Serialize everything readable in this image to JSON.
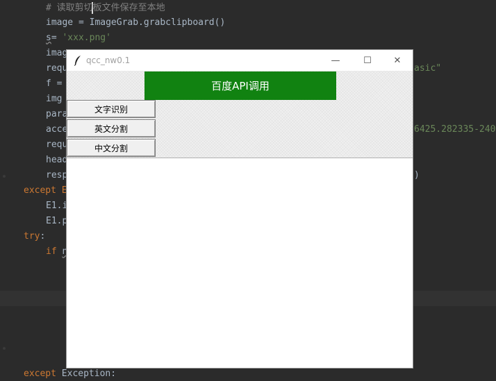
{
  "editor": {
    "lines": [
      {
        "id": "l1",
        "segments": [
          {
            "t": "# 读取剪切板文件保存至本地",
            "c": "c-comment"
          }
        ]
      },
      {
        "id": "l2",
        "segments": [
          {
            "t": "image = ImageGrab.grabclipboard()",
            "c": ""
          }
        ]
      },
      {
        "id": "l3",
        "segments": [
          {
            "t": "s",
            "c": "squiggle"
          },
          {
            "t": "= ",
            "c": ""
          },
          {
            "t": "'xxx.png'",
            "c": "c-str"
          }
        ]
      },
      {
        "id": "l4",
        "segments": [
          {
            "t": "imag",
            "c": ""
          }
        ]
      },
      {
        "id": "l5",
        "segments": [
          {
            "t": "requ",
            "c": ""
          }
        ]
      },
      {
        "id": "l6",
        "segments": [
          {
            "t": "f =",
            "c": ""
          }
        ]
      },
      {
        "id": "l7",
        "segments": [
          {
            "t": "img",
            "c": ""
          }
        ]
      },
      {
        "id": "l8",
        "segments": [
          {
            "t": "para",
            "c": ""
          }
        ]
      },
      {
        "id": "l9",
        "segments": [
          {
            "t": "acce",
            "c": ""
          }
        ]
      },
      {
        "id": "l10",
        "segments": [
          {
            "t": "requ",
            "c": ""
          }
        ]
      },
      {
        "id": "l11",
        "segments": [
          {
            "t": "head",
            "c": ""
          }
        ]
      },
      {
        "id": "l12",
        "segments": [
          {
            "t": "resp",
            "c": ""
          }
        ]
      },
      {
        "id": "l13",
        "segments": [
          {
            "t": "except E",
            "c": "c-kw"
          }
        ]
      },
      {
        "id": "l14",
        "segments": [
          {
            "t": "E1.i",
            "c": ""
          }
        ]
      },
      {
        "id": "l15",
        "segments": [
          {
            "t": "E1.p",
            "c": ""
          }
        ]
      },
      {
        "id": "l16",
        "segments": [
          {
            "t": "try",
            "c": "c-kw"
          },
          {
            "t": ":",
            "c": ""
          }
        ]
      },
      {
        "id": "l17",
        "segments": [
          {
            "t": "if ",
            "c": "c-kw"
          },
          {
            "t": "n",
            "c": "squiggle"
          }
        ]
      },
      {
        "id": "l18",
        "segments": [
          {
            "t": "except ",
            "c": "c-kw"
          },
          {
            "t": "Exception",
            "c": ""
          },
          {
            "t": ":",
            "c": ""
          }
        ]
      }
    ],
    "right_fragments": {
      "frag1": "asic\"",
      "frag2": "6425.282335-240",
      "frag3": ")"
    }
  },
  "window": {
    "title": "qcc_nw0.1",
    "minimize_glyph": "—",
    "maximize_glyph": "☐",
    "close_glyph": "✕",
    "api_button_label": "百度API调用",
    "ocr_button_label": "文字识别",
    "english_split_label": "英文分割",
    "chinese_split_label": "中文分割",
    "output_text": ""
  },
  "colors": {
    "editor_bg": "#2b2b2b",
    "api_button_bg": "#118211",
    "window_bg": "#f0f0f0"
  },
  "icons": {
    "app": "feather-icon"
  }
}
